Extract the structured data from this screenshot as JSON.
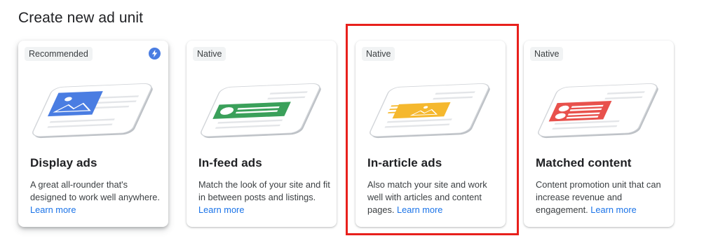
{
  "page": {
    "title": "Create new ad unit"
  },
  "colors": {
    "display_accent": "#4a7de2",
    "infeed_accent": "#3aa05a",
    "inarticle_accent": "#f5b82e",
    "matched_accent": "#e8514c",
    "highlight": "#e8201c",
    "link": "#1a73e8"
  },
  "cards": [
    {
      "badge": "Recommended",
      "icon": "lightning-bolt-icon",
      "title": "Display ads",
      "desc": "A great all-rounder that's designed to work well anywhere.",
      "link": "Learn more"
    },
    {
      "badge": "Native",
      "title": "In-feed ads",
      "desc": "Match the look of your site and fit in between posts and listings.",
      "link": "Learn more"
    },
    {
      "badge": "Native",
      "title": "In-article ads",
      "desc": "Also match your site and work well with articles and content pages.",
      "link": "Learn more",
      "highlighted": true
    },
    {
      "badge": "Native",
      "title": "Matched content",
      "desc": "Content promotion unit that can increase revenue and engagement.",
      "link": "Learn more"
    }
  ]
}
